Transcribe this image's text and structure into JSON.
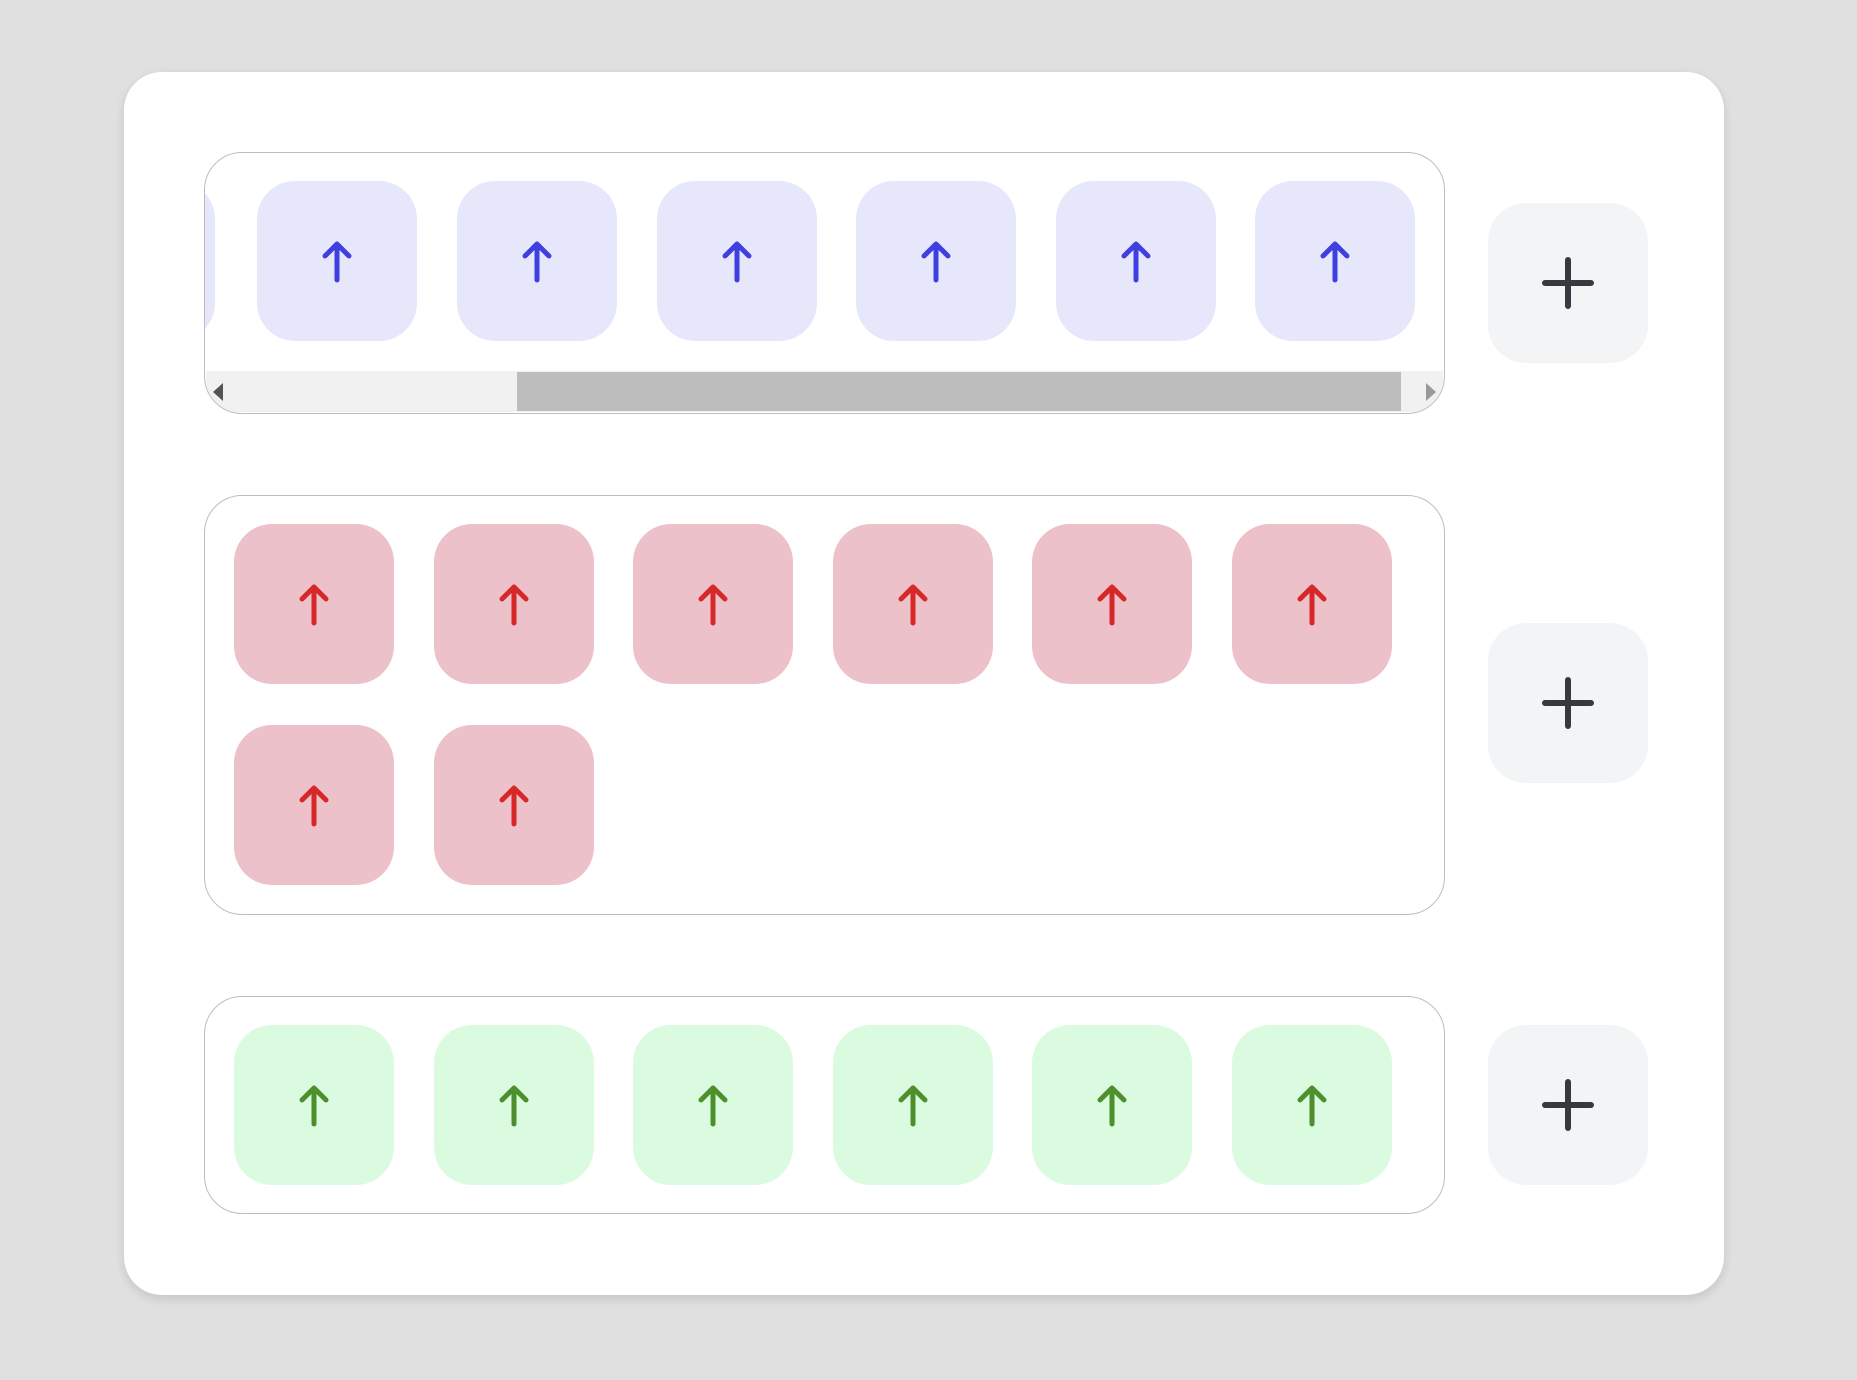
{
  "rows": [
    {
      "color": "blue",
      "tile_color": "#e6e7fb",
      "arrow_color": "#3f3fe0",
      "visible_tiles": 6,
      "partial_tile_left": true,
      "tile_icon": "arrow-up-icon",
      "add_icon": "plus-icon",
      "has_scrollbar": true,
      "scroll_position": 0.25
    },
    {
      "color": "red",
      "tile_color": "#edc1ca",
      "arrow_color": "#d62828",
      "visible_tiles": 8,
      "tile_icon": "arrow-up-icon",
      "add_icon": "plus-icon"
    },
    {
      "color": "green",
      "tile_color": "#dbfbe0",
      "arrow_color": "#4d8f2d",
      "visible_tiles": 6,
      "tile_icon": "arrow-up-icon",
      "add_icon": "plus-icon"
    }
  ],
  "colors": {
    "page_background": "#e0e0e0",
    "panel_background": "#ffffff",
    "add_button_background": "#f3f4f6",
    "add_icon_color": "#353a40",
    "track_border": "#bdbdbd",
    "scrollbar_thumb": "#bdbdbd"
  }
}
